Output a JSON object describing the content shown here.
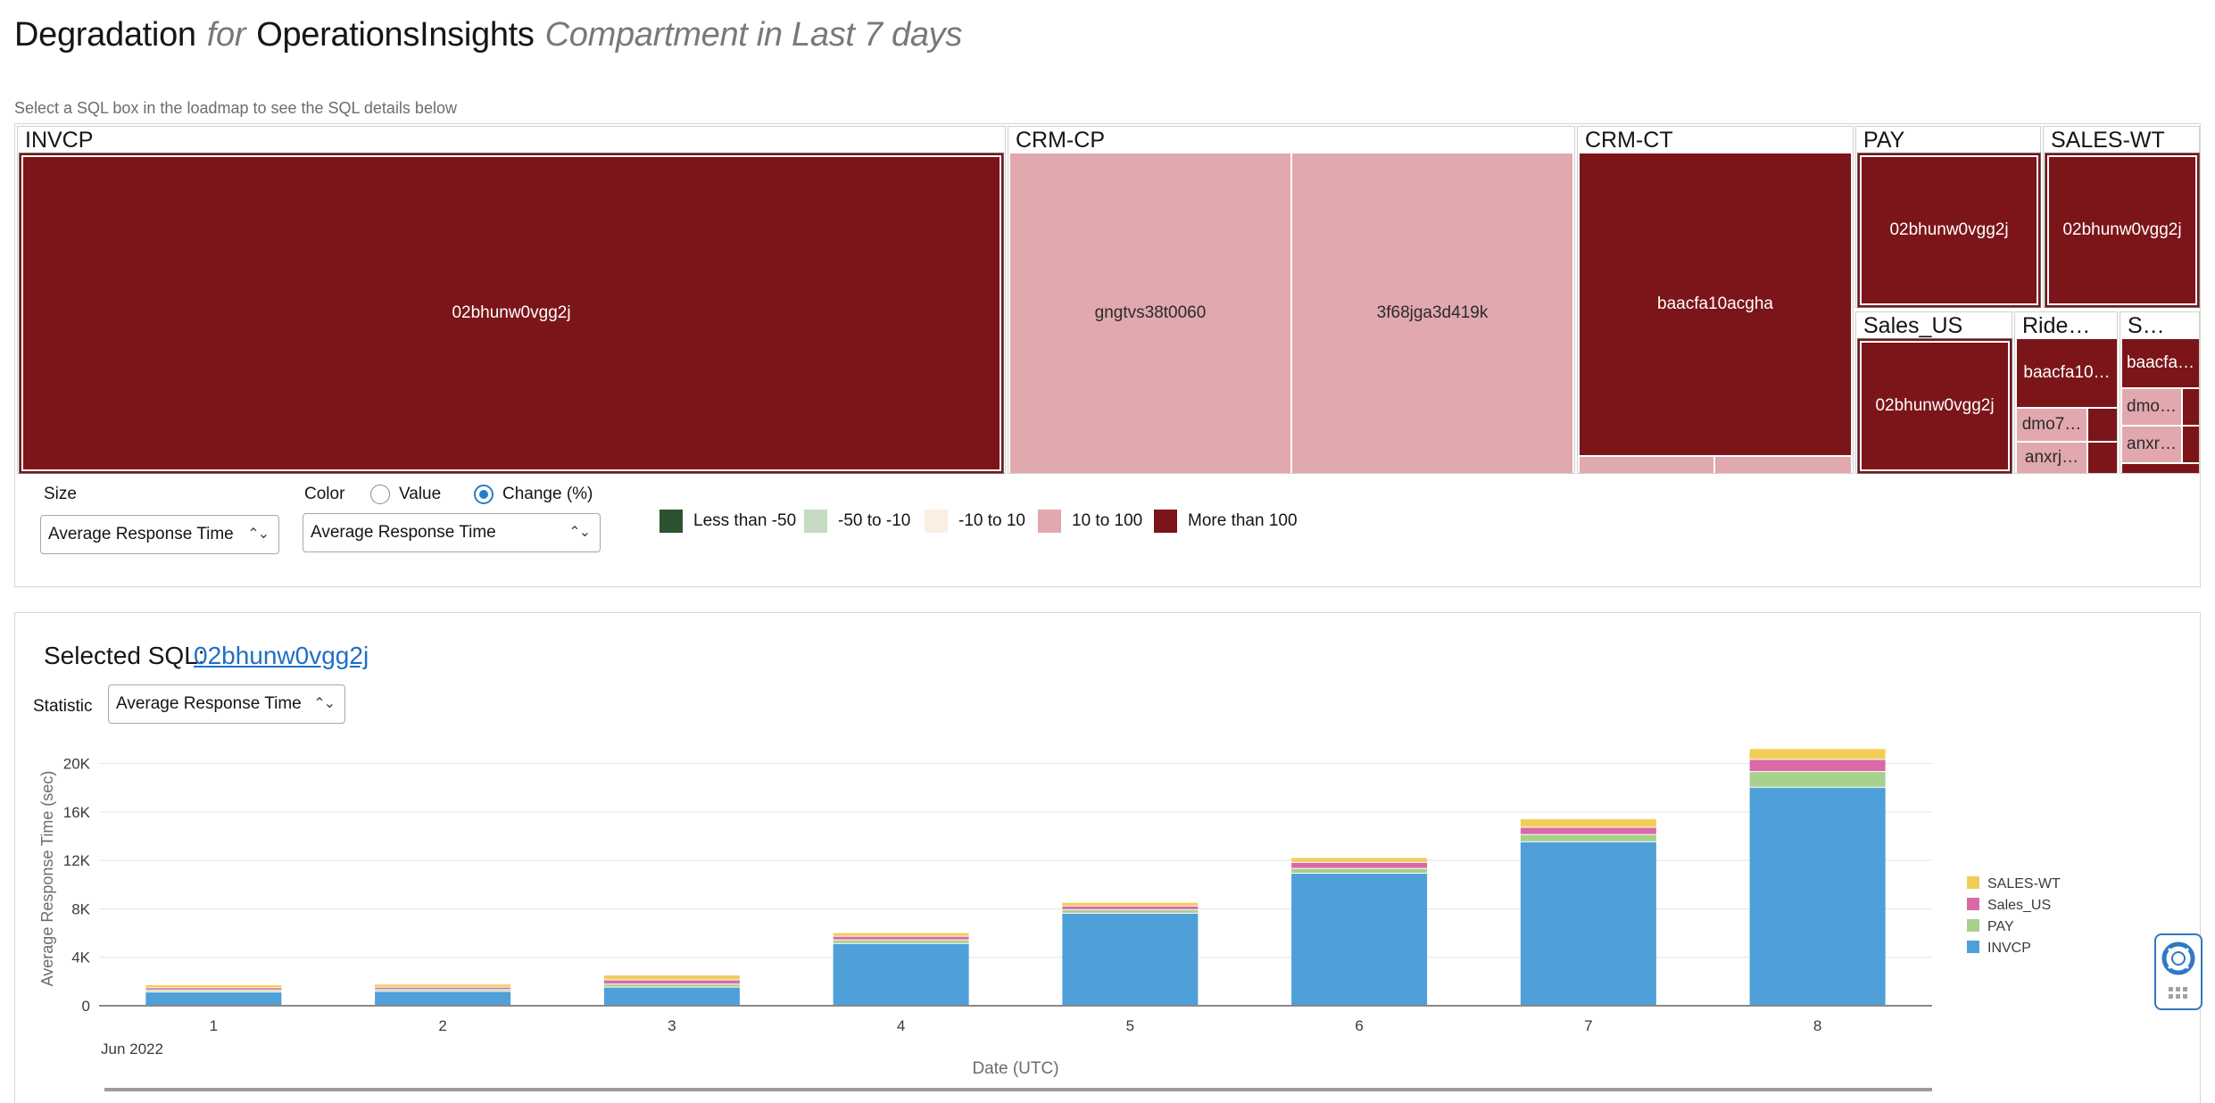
{
  "header": {
    "part1": "Degradation",
    "for": "for",
    "part2": "OperationsInsights",
    "part3": "Compartment in Last 7 days"
  },
  "hint": "Select a SQL box in the loadmap to see the SQL details below",
  "treemap": {
    "groups": {
      "invcp": "INVCP",
      "crmcp": "CRM-CP",
      "crmct": "CRM-CT",
      "pay": "PAY",
      "saleswt": "SALES-WT",
      "salesus": "Sales_US",
      "ride": "Ride…",
      "s": "S…"
    },
    "cells": {
      "invcp_main": "02bhunw0vgg2j",
      "crmcp_a": "gngtvs38t0060",
      "crmcp_b": "3f68jga3d419k",
      "crmct_main": "baacfa10acgha",
      "pay_main": "02bhunw0vgg2j",
      "saleswt_main": "02bhunw0vgg2j",
      "salesus_main": "02bhunw0vgg2j",
      "ride_a": "baacfa10…",
      "ride_b": "dmo7…",
      "ride_c": "anxrj…",
      "s_a": "baacfa…",
      "s_b": "dmo…",
      "s_c": "anxr…"
    },
    "colors": {
      "more_than_100": "#7b1519",
      "ten_to_100": "#e1a8ae"
    }
  },
  "controls": {
    "size_label": "Size",
    "size_value": "Average Response Time",
    "color_label": "Color",
    "radio_value": "Value",
    "radio_change": "Change (%)",
    "color_value": "Average Response Time",
    "selected_radio": "Change (%)"
  },
  "legend": [
    {
      "label": "Less than -50",
      "color": "#2d5230"
    },
    {
      "label": "-50 to -10",
      "color": "#c5dbc4"
    },
    {
      "label": "-10 to 10",
      "color": "#fbefe3"
    },
    {
      "label": "10 to 100",
      "color": "#e1a8ae"
    },
    {
      "label": "More than 100",
      "color": "#7b1519"
    }
  ],
  "details": {
    "selected_label": "Selected SQL:",
    "selected_sql": "02bhunw0vgg2j",
    "statistic_label": "Statistic",
    "statistic_value": "Average Response Time"
  },
  "chart_data": {
    "type": "bar",
    "stacked": true,
    "categories": [
      "1",
      "2",
      "3",
      "4",
      "5",
      "6",
      "7",
      "8"
    ],
    "x_period_label": "Jun 2022",
    "xlabel": "Date (UTC)",
    "ylabel": "Average Response Time (sec)",
    "ylim": [
      0,
      21000
    ],
    "yticks": [
      0,
      4000,
      8000,
      12000,
      16000,
      20000
    ],
    "ytick_labels": [
      "0",
      "4K",
      "8K",
      "12K",
      "16K",
      "20K"
    ],
    "grid": true,
    "legend_position": "right",
    "series": [
      {
        "name": "INVCP",
        "color": "#4f9fd9",
        "values": [
          1100,
          1150,
          1500,
          5100,
          7600,
          10900,
          13500,
          18000
        ]
      },
      {
        "name": "PAY",
        "color": "#a7d08c",
        "values": [
          150,
          150,
          250,
          300,
          300,
          400,
          600,
          1300
        ]
      },
      {
        "name": "Sales_US",
        "color": "#d96aa5",
        "values": [
          200,
          200,
          350,
          300,
          300,
          500,
          600,
          1000
        ]
      },
      {
        "name": "SALES-WT",
        "color": "#f2cd56",
        "values": [
          250,
          250,
          400,
          300,
          300,
          400,
          700,
          900
        ]
      }
    ]
  }
}
